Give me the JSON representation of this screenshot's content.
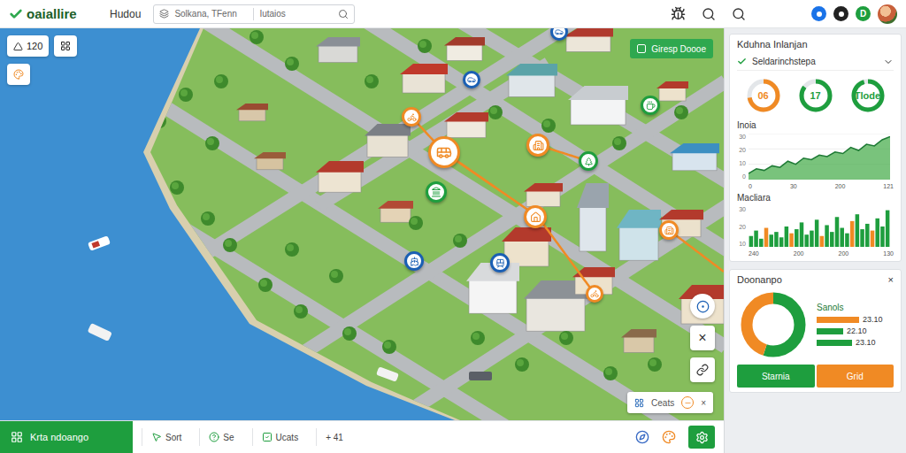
{
  "header": {
    "logo": "oaiallire",
    "nav": "Hudou",
    "search": {
      "value": "Solkana, TFenn",
      "filter": "Iutaios"
    },
    "avatars": [
      {
        "kind": "badge",
        "color": "#1a73e8"
      },
      {
        "kind": "badge",
        "color": "#222222"
      },
      {
        "kind": "letter",
        "label": "D",
        "color": "#1e9e3e"
      },
      {
        "kind": "photo",
        "color": "#c8603a"
      }
    ]
  },
  "map": {
    "count": "120",
    "layer_tag": {
      "label": "Giresp Doooe",
      "checked": false
    },
    "pins": [
      {
        "color": "#f08a24"
      },
      {
        "color": "#f08a24"
      },
      {
        "color": "#1a5fb4"
      },
      {
        "color": "#1e9e3e"
      },
      {
        "color": "#f08a24"
      },
      {
        "color": "#1e9e3e"
      },
      {
        "color": "#1e9e3e"
      },
      {
        "color": "#f08a24"
      },
      {
        "color": "#1a5fb4"
      },
      {
        "color": "#1a5fb4"
      },
      {
        "color": "#f08a24"
      },
      {
        "color": "#f08a24"
      },
      {
        "color": "#1a5fb4"
      }
    ],
    "controls": {
      "close": "×"
    },
    "legend_panel": {
      "label": "Ceats",
      "close": "×"
    }
  },
  "bottom_bar": {
    "primary": "Krta ndoango",
    "tools": [
      {
        "label": "Sort"
      },
      {
        "label": "Se"
      },
      {
        "label": "Ucats"
      },
      {
        "label": "+ 41"
      }
    ]
  },
  "panel": {
    "title": "Kduhna Inlanjan",
    "select": {
      "value": "Seldarinchstepa",
      "expanded": false
    },
    "rings": [
      {
        "label": "06",
        "level": 0.72,
        "color": "#f08a24"
      },
      {
        "label": "17",
        "level": 0.85,
        "color": "#1e9e3e"
      },
      {
        "label": "Tlode",
        "level": 0.95,
        "color": "#1e9e3e"
      }
    ],
    "area_chart": {
      "title": "Inoia",
      "y_ticks": [
        "30",
        "20",
        "10",
        "0"
      ],
      "x_ticks": [
        "0",
        "30",
        "200",
        "121"
      ],
      "values": [
        4,
        7,
        6,
        9,
        8,
        12,
        10,
        14,
        13,
        16,
        15,
        18,
        17,
        21,
        19,
        23,
        22,
        26,
        28
      ]
    },
    "bar_chart": {
      "title": "Macliara",
      "y_ticks": [
        "30",
        "20",
        "10"
      ],
      "x_ticks": [
        "240",
        "200",
        "200",
        "130"
      ],
      "bars": [
        {
          "value": 8,
          "color": "#1e9e3e"
        },
        {
          "value": 12,
          "color": "#1e9e3e"
        },
        {
          "value": 6,
          "color": "#1e9e3e"
        },
        {
          "value": 14,
          "color": "#f08a24"
        },
        {
          "value": 9,
          "color": "#1e9e3e"
        },
        {
          "value": 11,
          "color": "#1e9e3e"
        },
        {
          "value": 7,
          "color": "#1e9e3e"
        },
        {
          "value": 15,
          "color": "#1e9e3e"
        },
        {
          "value": 10,
          "color": "#f08a24"
        },
        {
          "value": 13,
          "color": "#1e9e3e"
        },
        {
          "value": 18,
          "color": "#1e9e3e"
        },
        {
          "value": 9,
          "color": "#1e9e3e"
        },
        {
          "value": 12,
          "color": "#1e9e3e"
        },
        {
          "value": 20,
          "color": "#1e9e3e"
        },
        {
          "value": 8,
          "color": "#f08a24"
        },
        {
          "value": 16,
          "color": "#1e9e3e"
        },
        {
          "value": 11,
          "color": "#1e9e3e"
        },
        {
          "value": 22,
          "color": "#1e9e3e"
        },
        {
          "value": 14,
          "color": "#1e9e3e"
        },
        {
          "value": 10,
          "color": "#1e9e3e"
        },
        {
          "value": 19,
          "color": "#f08a24"
        },
        {
          "value": 24,
          "color": "#1e9e3e"
        },
        {
          "value": 13,
          "color": "#1e9e3e"
        },
        {
          "value": 17,
          "color": "#1e9e3e"
        },
        {
          "value": 12,
          "color": "#f08a24"
        },
        {
          "value": 21,
          "color": "#1e9e3e"
        },
        {
          "value": 15,
          "color": "#1e9e3e"
        },
        {
          "value": 27,
          "color": "#1e9e3e"
        }
      ]
    }
  },
  "details": {
    "title": "Doonanpo",
    "close": "×",
    "donut": [
      {
        "level": 0.55,
        "color": "#1e9e3e"
      },
      {
        "level": 0.45,
        "color": "#f08a24"
      }
    ],
    "legend_title": "Sanols",
    "legend": [
      {
        "reading": "23.10",
        "level": 0.95,
        "color": "#f08a24"
      },
      {
        "reading": "22.10",
        "level": 0.6,
        "color": "#1e9e3e"
      },
      {
        "reading": "23.10",
        "level": 0.8,
        "color": "#1e9e3e"
      }
    ],
    "buttons": [
      {
        "label": "Starnia",
        "color": "#1e9e3e"
      },
      {
        "label": "Grid",
        "color": "#f08a24"
      }
    ]
  }
}
